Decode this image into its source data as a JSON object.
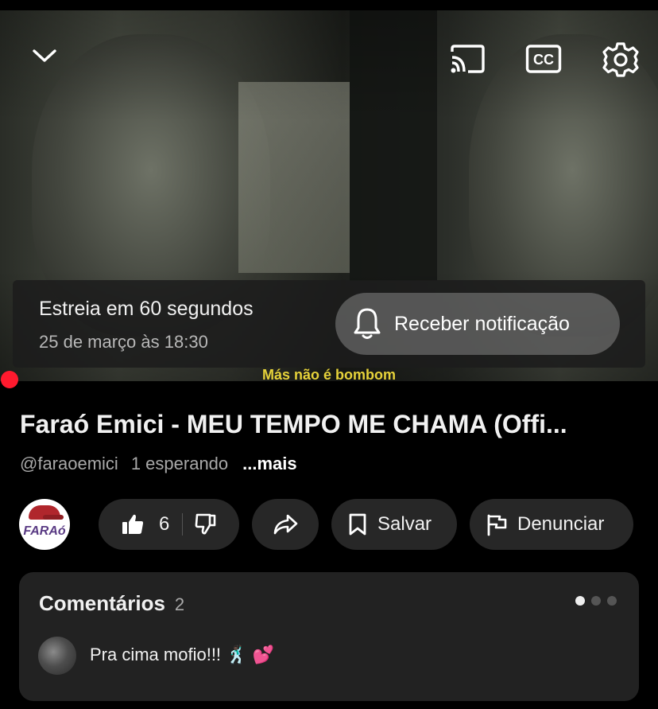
{
  "player": {
    "subtitle": "Más não é bombom",
    "icons": {
      "collapse": "chevron-down-icon",
      "cast": "cast-icon",
      "captions": "cc-icon",
      "settings": "gear-icon"
    },
    "captions_glyph": "CC",
    "premiere": {
      "line1": "Estreia em 60 segundos",
      "line2": "25 de março às 18:30",
      "notify_label": "Receber notificação"
    },
    "progress_color": "#ff1a2e"
  },
  "video": {
    "title": "Faraó Emici - MEU TEMPO ME CHAMA (Offi...",
    "handle": "@faraoemici",
    "waiting": "1 esperando",
    "more": "...mais"
  },
  "channel": {
    "avatar_text": "FARAó"
  },
  "actions": {
    "like_count": "6",
    "save_label": "Salvar",
    "report_label": "Denunciar"
  },
  "comments": {
    "title": "Comentários",
    "count": "2",
    "first_comment": "Pra cima mofio!!! 🕺🏿 💕"
  }
}
